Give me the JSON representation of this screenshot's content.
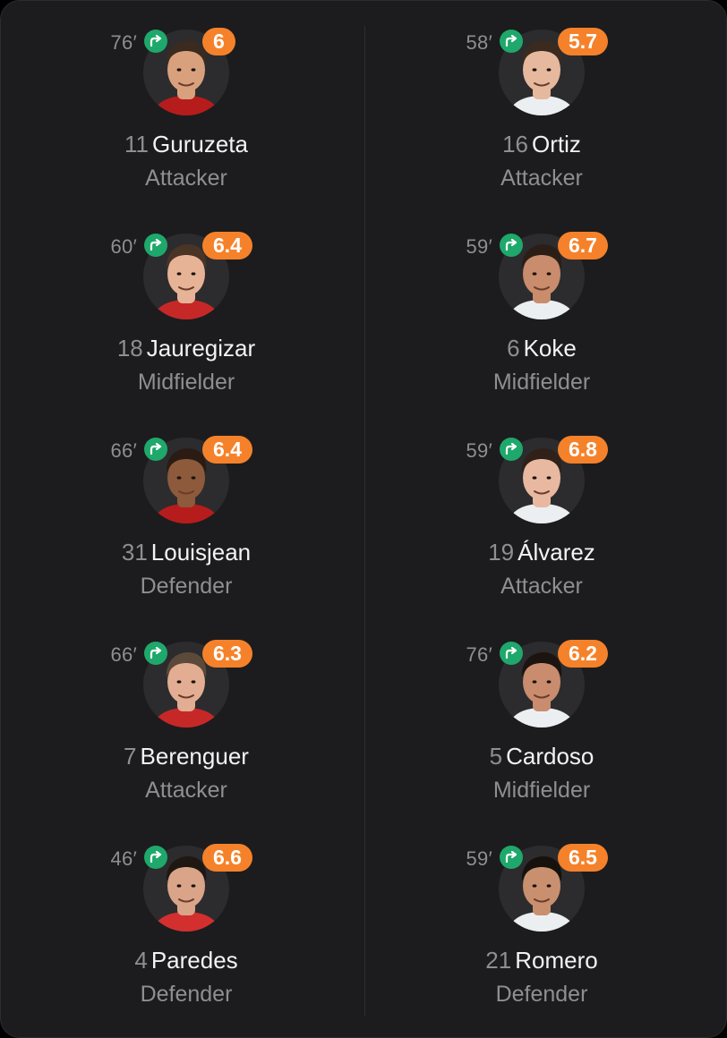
{
  "left_team": [
    {
      "minute": "76′",
      "rating": "6",
      "number": "11",
      "name": "Guruzeta",
      "position": "Attacker",
      "skin": "#d9a07d",
      "hair": "#3a2a1f",
      "shirt_color": "#b71c1c"
    },
    {
      "minute": "60′",
      "rating": "6.4",
      "number": "18",
      "name": "Jauregizar",
      "position": "Midfielder",
      "skin": "#e7b396",
      "hair": "#4a3426",
      "shirt_color": "#c62828"
    },
    {
      "minute": "66′",
      "rating": "6.4",
      "number": "31",
      "name": "Louisjean",
      "position": "Defender",
      "skin": "#8d5a3c",
      "hair": "#2a1c14",
      "shirt_color": "#b71c1c"
    },
    {
      "minute": "66′",
      "rating": "6.3",
      "number": "7",
      "name": "Berenguer",
      "position": "Attacker",
      "skin": "#e2ad92",
      "hair": "#5b4a3a",
      "shirt_color": "#c62828"
    },
    {
      "minute": "46′",
      "rating": "6.6",
      "number": "4",
      "name": "Paredes",
      "position": "Defender",
      "skin": "#d9a488",
      "hair": "#1f1712",
      "shirt_color": "#d32f2f"
    }
  ],
  "right_team": [
    {
      "minute": "58′",
      "rating": "5.7",
      "number": "16",
      "name": "Ortiz",
      "position": "Attacker",
      "skin": "#e6b89d",
      "hair": "#3b2a20",
      "shirt_color": "#eceff1"
    },
    {
      "minute": "59′",
      "rating": "6.7",
      "number": "6",
      "name": "Koke",
      "position": "Midfielder",
      "skin": "#c98c6c",
      "hair": "#2b1e16",
      "shirt_color": "#eceff1"
    },
    {
      "minute": "59′",
      "rating": "6.8",
      "number": "19",
      "name": "Álvarez",
      "position": "Attacker",
      "skin": "#e8b9a0",
      "hair": "#2f2119",
      "shirt_color": "#eceff1"
    },
    {
      "minute": "76′",
      "rating": "6.2",
      "number": "5",
      "name": "Cardoso",
      "position": "Midfielder",
      "skin": "#c98c6e",
      "hair": "#1c1410",
      "shirt_color": "#eceff1"
    },
    {
      "minute": "59′",
      "rating": "6.5",
      "number": "21",
      "name": "Romero",
      "position": "Defender",
      "skin": "#c9906f",
      "hair": "#16110d",
      "shirt_color": "#eceff1"
    }
  ],
  "colors": {
    "card_background": "#1c1c1e",
    "rating_badge": "#f5822a",
    "substitution_icon": "#1fa86b",
    "secondary_text": "#8e8e93",
    "primary_text": "#f2f2f7"
  },
  "icons": {
    "substitution": "sub-off-arrow-icon"
  }
}
